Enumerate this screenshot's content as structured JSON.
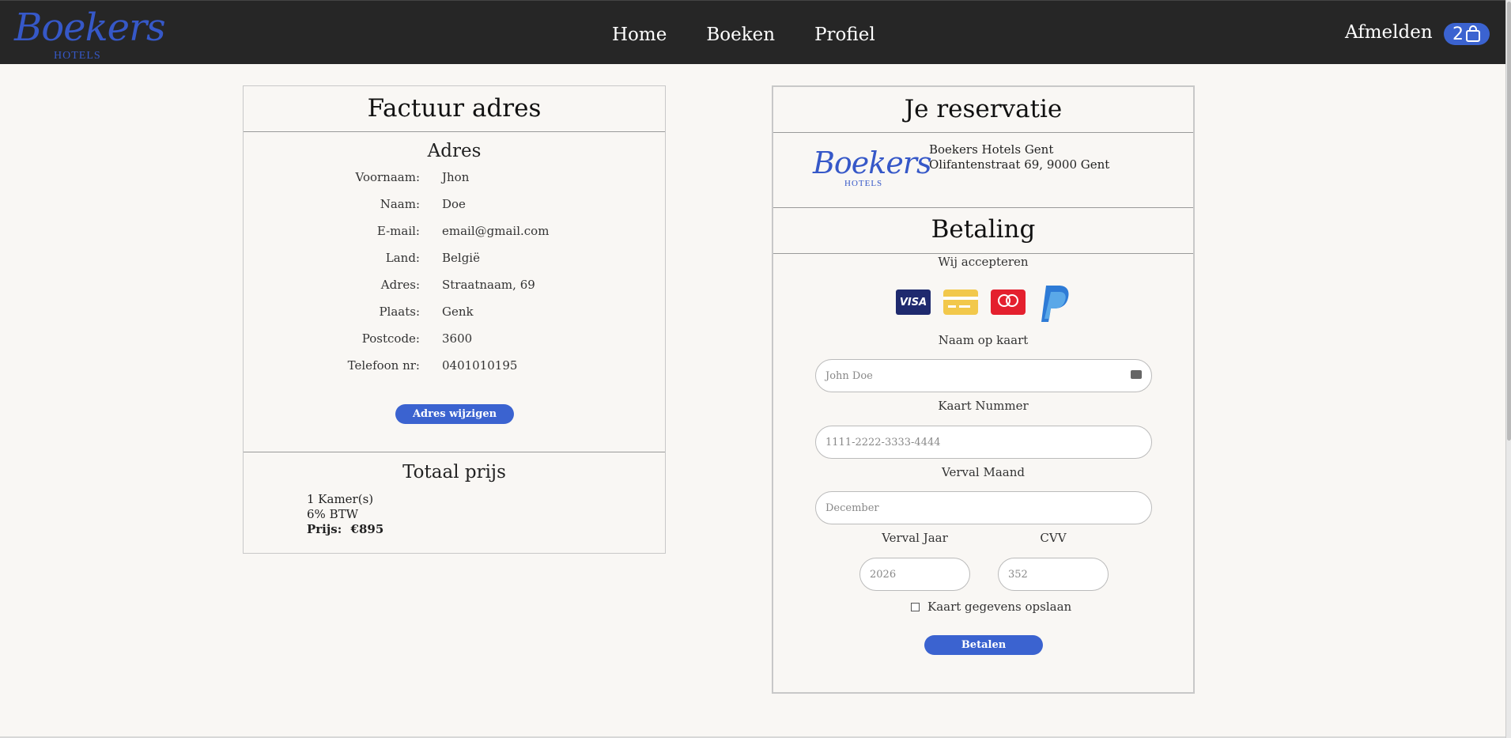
{
  "nav": {
    "logo_script": "Boekers",
    "logo_sub": "HOTELS",
    "links": [
      "Home",
      "Boeken",
      "Profiel"
    ],
    "logout": "Afmelden",
    "cart_count": "2"
  },
  "billing": {
    "title": "Factuur adres",
    "subtitle": "Adres",
    "rows": [
      {
        "label": "Voornaam:",
        "value": "Jhon"
      },
      {
        "label": "Naam:",
        "value": "Doe"
      },
      {
        "label": "E-mail:",
        "value": "email@gmail.com"
      },
      {
        "label": "Land:",
        "value": "België"
      },
      {
        "label": "Adres:",
        "value": "Straatnaam, 69"
      },
      {
        "label": "Plaats:",
        "value": "Genk"
      },
      {
        "label": "Postcode:",
        "value": "3600"
      },
      {
        "label": "Telefoon nr:",
        "value": "0401010195"
      }
    ],
    "change_button": "Adres wijzigen",
    "total_title": "Totaal prijs",
    "rooms": "1 Kamer(s)",
    "vat": "6% BTW",
    "price_label": "Prijs:",
    "price_value": "€895"
  },
  "reservation": {
    "title": "Je reservatie",
    "hotel_name": "Boekers Hotels Gent",
    "hotel_address": "Olifantenstraat 69, 9000 Gent",
    "payment_title": "Betaling",
    "accept_text": "Wij accepteren",
    "card_icons": [
      "visa-icon",
      "credit-card-icon",
      "mastercard-icon",
      "paypal-icon"
    ],
    "card_name_label": "Naam op kaart",
    "card_name_placeholder": "John Doe",
    "card_number_label": "Kaart Nummer",
    "card_number_placeholder": "1111-2222-3333-4444",
    "exp_month_label": "Verval Maand",
    "exp_month_placeholder": "December",
    "exp_year_label": "Verval Jaar",
    "exp_year_placeholder": "2026",
    "cvv_label": "CVV",
    "cvv_placeholder": "352",
    "save_label": "Kaart gegevens opslaan",
    "save_checked": false,
    "pay_button": "Betalen"
  },
  "colors": {
    "accent": "#3b63d0",
    "topbar": "#262626",
    "background": "#f9f7f4"
  }
}
